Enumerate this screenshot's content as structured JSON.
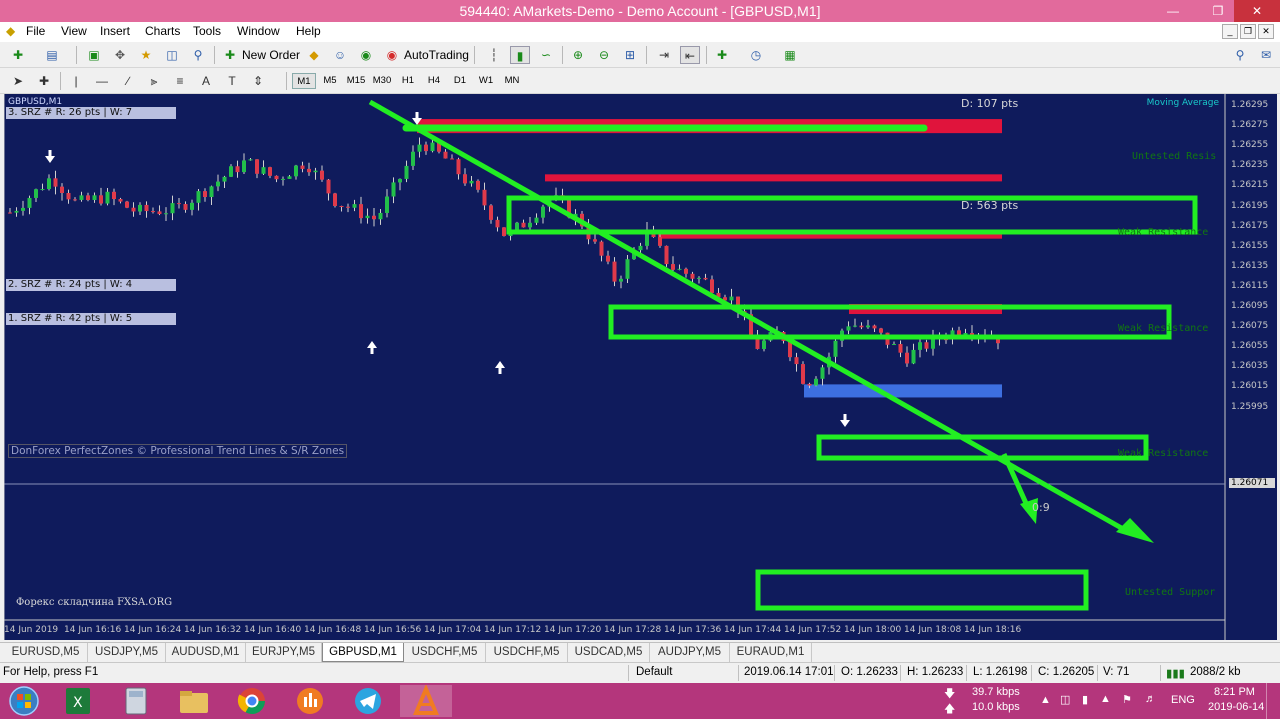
{
  "window": {
    "title": "594440: AMarkets-Demo - Demo Account - [GBPUSD,M1]"
  },
  "menu": [
    "File",
    "View",
    "Insert",
    "Charts",
    "Tools",
    "Window",
    "Help"
  ],
  "toolbar": {
    "new_order": "New Order",
    "autotrading": "AutoTrading"
  },
  "timeframes": [
    "M1",
    "M5",
    "M15",
    "M30",
    "H1",
    "H4",
    "D1",
    "W1",
    "MN"
  ],
  "active_timeframe": "M1",
  "chart": {
    "symbol_label": "GBPUSD,M1",
    "srz": [
      "3. SRZ # R: 26 pts | W: 7",
      "2. SRZ # R: 24 pts | W: 4",
      "1. SRZ # R: 42 pts | W: 5"
    ],
    "d_labels": [
      "D: 107 pts",
      "D: 563 pts"
    ],
    "zone_labels": [
      "Untested Resis",
      "Weak Resistance",
      "Weak Resistance",
      "Weak Resistance",
      "Untested Suppor"
    ],
    "indicator": "Moving Average",
    "watermark": "DonForex PerfectZones © Professional Trend Lines & S/R Zones",
    "site": "Форекс складчина FXSA.ORG",
    "countdown": "0:9",
    "price_axis": [
      "1.26295",
      "1.26275",
      "1.26255",
      "1.26235",
      "1.26215",
      "1.26195",
      "1.26175",
      "1.26155",
      "1.26135",
      "1.26115",
      "1.26095",
      "1.26075",
      "1.26055",
      "1.26035",
      "1.26015",
      "1.25995"
    ],
    "current_price": "1.26071",
    "time_axis": [
      "14 Jun 2019",
      "14 Jun 16:16",
      "14 Jun 16:24",
      "14 Jun 16:32",
      "14 Jun 16:40",
      "14 Jun 16:48",
      "14 Jun 16:56",
      "14 Jun 17:04",
      "14 Jun 17:12",
      "14 Jun 17:20",
      "14 Jun 17:28",
      "14 Jun 17:36",
      "14 Jun 17:44",
      "14 Jun 17:52",
      "14 Jun 18:00",
      "14 Jun 18:08",
      "14 Jun 18:16"
    ]
  },
  "symbol_tabs": [
    "EURUSD,M5",
    "USDJPY,M5",
    "AUDUSD,M1",
    "EURJPY,M5",
    "GBPUSD,M1",
    "USDCHF,M5",
    "USDCHF,M5",
    "USDCAD,M5",
    "AUDJPY,M5",
    "EURAUD,M1"
  ],
  "active_tab": "GBPUSD,M1",
  "status": {
    "help": "For Help, press F1",
    "profile": "Default",
    "time": "2019.06.14 17:01",
    "open": "O: 1.26233",
    "high": "H: 1.26233",
    "low": "L: 1.26198",
    "close": "C: 1.26205",
    "volume": "V: 71",
    "traffic": "2088/2 kb"
  },
  "taskbar": {
    "net_down": "39.7 kbps",
    "net_up": "10.0 kbps",
    "lang": "ENG",
    "time": "8:21 PM",
    "date": "2019-06-14"
  },
  "colors": {
    "chart_bg": "#0f1b5c",
    "bull": "#22c04a",
    "bear": "#e03a4a",
    "resistance_zone": "#e0143c",
    "support_zone": "#3d6fe0",
    "annotation": "#22ee22",
    "titlebar": "#e26a9c",
    "taskbar": "#b4367c"
  }
}
